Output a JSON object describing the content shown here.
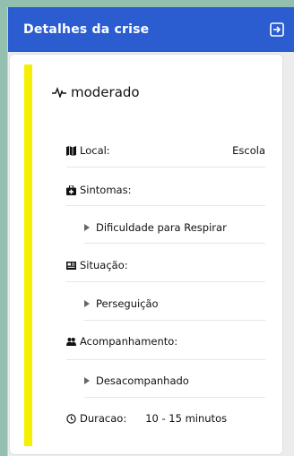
{
  "header": {
    "title": "Detalhes da crise",
    "exit_icon": "exit-icon"
  },
  "severity": {
    "level": "moderado",
    "color": "#f5f000",
    "icon": "pulse-icon"
  },
  "details": {
    "local_label": "Local:",
    "local_value": "Escola",
    "sintomas_label": "Sintomas:",
    "sintomas_items": [
      "Dificuldade para Respirar"
    ],
    "situacao_label": "Situação:",
    "situacao_items": [
      "Perseguição"
    ],
    "acompanhamento_label": "Acompanhamento:",
    "acompanhamento_items": [
      "Desacompanhado"
    ],
    "duracao_label": "Duracao:",
    "duracao_value": "10 - 15 minutos"
  },
  "colors": {
    "header": "#2b5dd0",
    "background": "#93bfae"
  }
}
